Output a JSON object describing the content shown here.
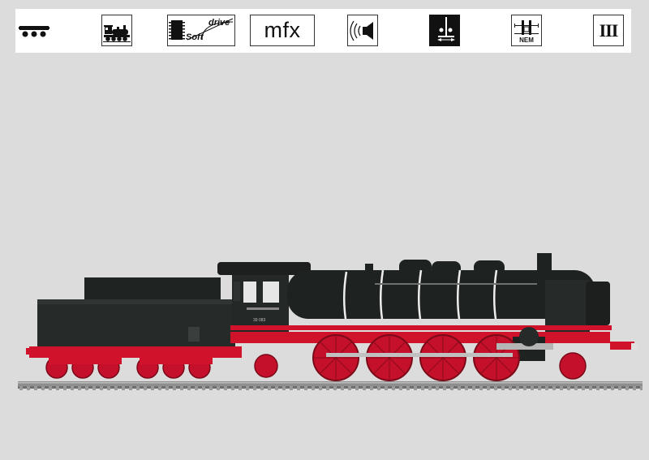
{
  "icons": [
    {
      "name": "coach-length-icon"
    },
    {
      "name": "steam-locomotive-icon"
    },
    {
      "name": "soft-drive-icon",
      "soft": "Soft",
      "drive": "drive"
    },
    {
      "name": "mfx-decoder-icon",
      "text": "mfx"
    },
    {
      "name": "sound-icon"
    },
    {
      "name": "digital-coupler-icon"
    },
    {
      "name": "nem-coupler-pocket-icon",
      "text": "NEM"
    },
    {
      "name": "era-icon",
      "text": "III"
    }
  ],
  "locomotive": {
    "number": "39 083",
    "body_color": "#222524",
    "frame_color": "#d0132a",
    "rail_color": "#888888"
  }
}
